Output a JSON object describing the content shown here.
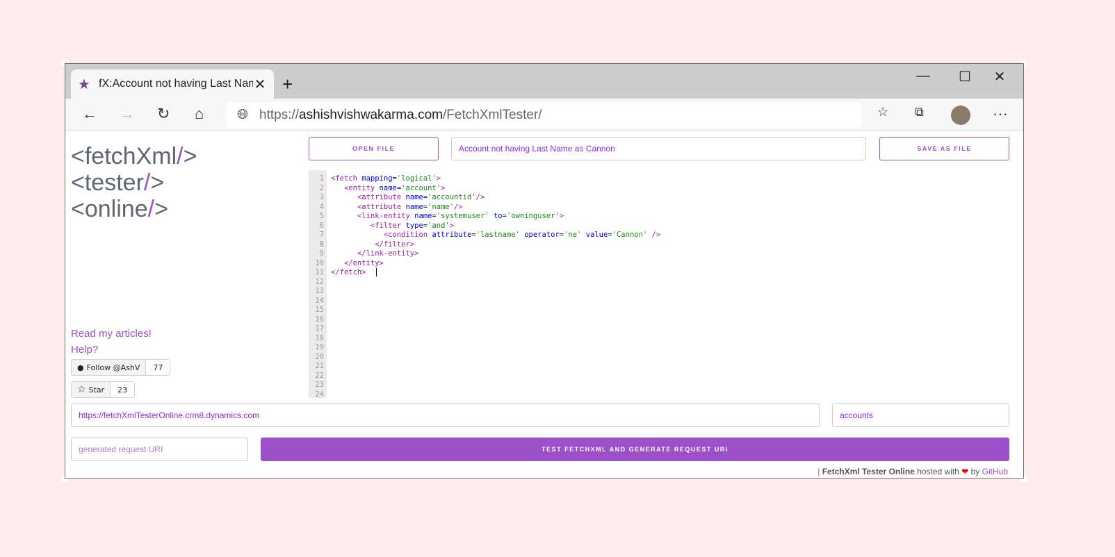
{
  "browser": {
    "tab_title": "fX:Account not having Last Name as Cannon",
    "url_prefix": "https://",
    "url_domain": "ashishvishwakarma.com",
    "url_path": "/FetchXmlTester/"
  },
  "logo": {
    "l1a": "<fetchXml",
    "l2a": "<tester",
    "l3a": "<online",
    "slash": "/",
    "end": ">"
  },
  "links": {
    "articles": "Read my articles!",
    "help": "Help?"
  },
  "github": {
    "follow_label": "Follow @AshV",
    "followers": "77",
    "star_label": "Star",
    "stars": "23"
  },
  "toolbar": {
    "open_file": "OPEN FILE",
    "title_value": "Account not having Last Name as Cannon",
    "save_file": "SAVE AS FILE"
  },
  "editor": {
    "line_count": 24,
    "lines": [
      [
        [
          "tg",
          "<fetch "
        ],
        [
          "at",
          "mapping"
        ],
        [
          "",
          "="
        ],
        [
          "vl",
          "'logical'"
        ],
        [
          "tg",
          ">"
        ]
      ],
      [
        [
          "",
          "   "
        ],
        [
          "tg",
          "<entity "
        ],
        [
          "at",
          "name"
        ],
        [
          "",
          "="
        ],
        [
          "vl",
          "'account'"
        ],
        [
          "tg",
          ">"
        ]
      ],
      [
        [
          "",
          "      "
        ],
        [
          "tg",
          "<attribute "
        ],
        [
          "at",
          "name"
        ],
        [
          "",
          "="
        ],
        [
          "vl",
          "'accountid'"
        ],
        [
          "tg",
          "/>"
        ]
      ],
      [
        [
          "",
          "      "
        ],
        [
          "tg",
          "<attribute "
        ],
        [
          "at",
          "name"
        ],
        [
          "",
          "="
        ],
        [
          "vl",
          "'name'"
        ],
        [
          "tg",
          "/>"
        ]
      ],
      [
        [
          "",
          "      "
        ],
        [
          "tg",
          "<link-entity "
        ],
        [
          "at",
          "name"
        ],
        [
          "",
          "="
        ],
        [
          "vl",
          "'systemuser'"
        ],
        [
          "",
          " "
        ],
        [
          "at",
          "to"
        ],
        [
          "",
          "="
        ],
        [
          "vl",
          "'owninguser'"
        ],
        [
          "tg",
          ">"
        ]
      ],
      [
        [
          "",
          "         "
        ],
        [
          "tg",
          "<filter "
        ],
        [
          "at",
          "type"
        ],
        [
          "",
          "="
        ],
        [
          "vl",
          "'and'"
        ],
        [
          "tg",
          ">"
        ]
      ],
      [
        [
          "",
          "            "
        ],
        [
          "tg",
          "<condition "
        ],
        [
          "at",
          "attribute"
        ],
        [
          "",
          "="
        ],
        [
          "vl",
          "'lastname'"
        ],
        [
          "",
          " "
        ],
        [
          "at",
          "operator"
        ],
        [
          "",
          "="
        ],
        [
          "vl",
          "'ne'"
        ],
        [
          "",
          " "
        ],
        [
          "at",
          "value"
        ],
        [
          "",
          "="
        ],
        [
          "vl",
          "'Cannon'"
        ],
        [
          "tg",
          " />"
        ]
      ],
      [
        [
          "",
          "          "
        ],
        [
          "tg",
          "</filter>"
        ]
      ],
      [
        [
          "",
          "      "
        ],
        [
          "tg",
          "</link-entity>"
        ]
      ],
      [
        [
          "",
          "   "
        ],
        [
          "tg",
          "</entity>"
        ]
      ],
      [
        [
          "tg",
          "</fetch>"
        ]
      ]
    ]
  },
  "org": {
    "url": "https://fetchXmlTesterOnline.crm8.dynamics.com",
    "entity": "accounts"
  },
  "request": {
    "placeholder": "generated request URI",
    "test_button": "TEST FETCHXML AND GENERATE REQUEST URI"
  },
  "footer": {
    "sep": "| ",
    "name": "FetchXml Tester Online",
    "hosted": " hosted with ",
    "by": " by ",
    "github": "GitHub"
  },
  "colors": {
    "accent": "#9b4fc9",
    "tag": "#a020a0",
    "attr": "#0000e0",
    "value": "#1a8a1a"
  }
}
